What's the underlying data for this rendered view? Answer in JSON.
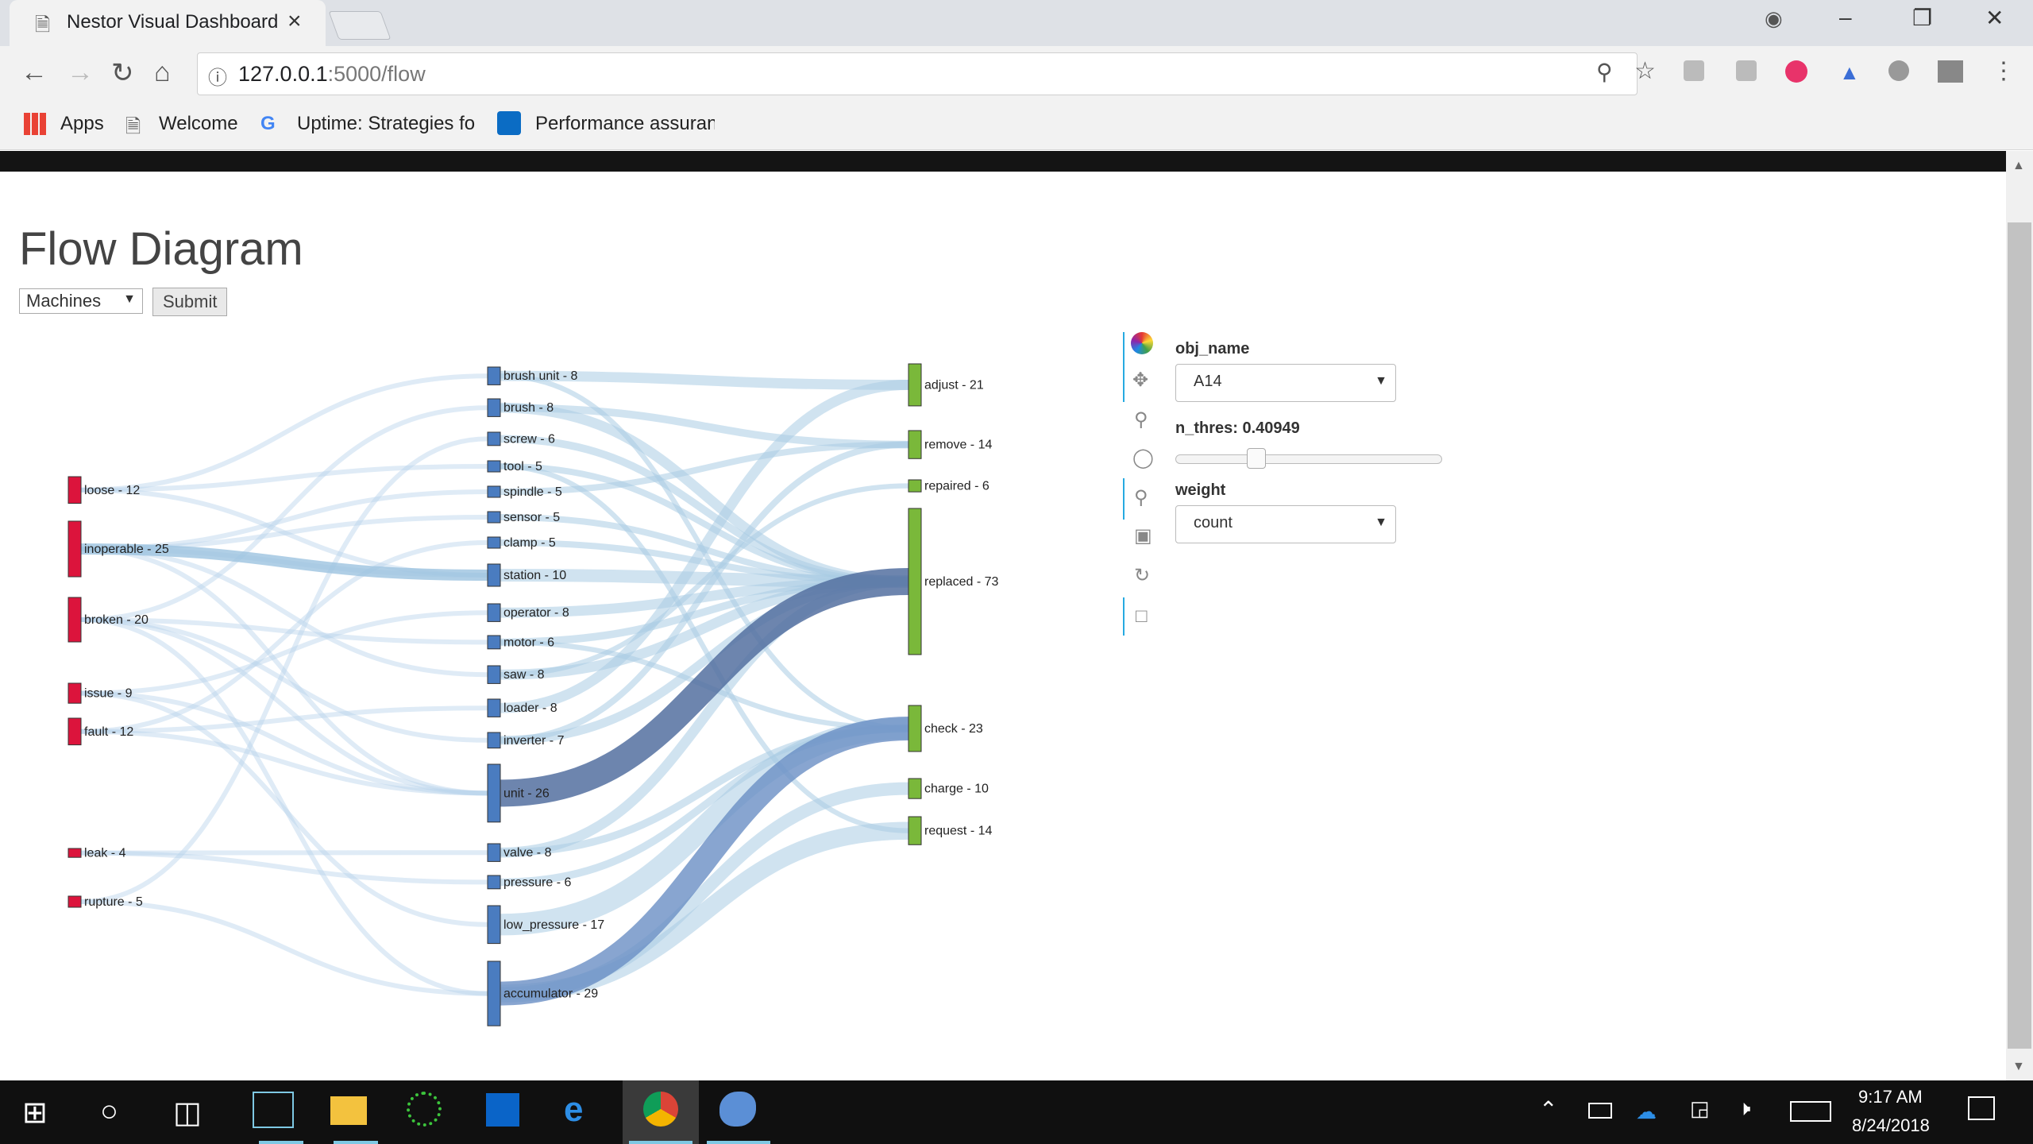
{
  "browser": {
    "tab_title": "Nestor Visual Dashboard",
    "url_host": "127.0.0.1",
    "url_path": ":5000/flow",
    "bookmarks": [
      "Apps",
      "Welcome",
      "Uptime: Strategies fo",
      "Performance assuran"
    ]
  },
  "page": {
    "title": "Flow Diagram",
    "category_select": "Machines",
    "submit_label": "Submit"
  },
  "widgets": {
    "obj_name_label": "obj_name",
    "obj_name_value": "A14",
    "threshold_label": "n_thres: 0.40949",
    "threshold_value": 0.40949,
    "weight_label": "weight",
    "weight_value": "count"
  },
  "diagram": {
    "problems": [
      {
        "label": "loose - 12",
        "count": 12
      },
      {
        "label": "inoperable - 25",
        "count": 25
      },
      {
        "label": "broken - 20",
        "count": 20
      },
      {
        "label": "issue - 9",
        "count": 9
      },
      {
        "label": "fault - 12",
        "count": 12
      },
      {
        "label": "leak - 4",
        "count": 4
      },
      {
        "label": "rupture - 5",
        "count": 5
      }
    ],
    "items": [
      {
        "label": "brush unit - 8",
        "count": 8
      },
      {
        "label": "brush - 8",
        "count": 8
      },
      {
        "label": "screw - 6",
        "count": 6
      },
      {
        "label": "tool - 5",
        "count": 5
      },
      {
        "label": "spindle - 5",
        "count": 5
      },
      {
        "label": "sensor - 5",
        "count": 5
      },
      {
        "label": "clamp - 5",
        "count": 5
      },
      {
        "label": "station - 10",
        "count": 10
      },
      {
        "label": "operator - 8",
        "count": 8
      },
      {
        "label": "motor - 6",
        "count": 6
      },
      {
        "label": "saw - 8",
        "count": 8
      },
      {
        "label": "loader - 8",
        "count": 8
      },
      {
        "label": "inverter - 7",
        "count": 7
      },
      {
        "label": "unit - 26",
        "count": 26
      },
      {
        "label": "valve - 8",
        "count": 8
      },
      {
        "label": "pressure - 6",
        "count": 6
      },
      {
        "label": "low_pressure - 17",
        "count": 17
      },
      {
        "label": "accumulator - 29",
        "count": 29
      }
    ],
    "solutions": [
      {
        "label": "adjust - 21",
        "count": 21
      },
      {
        "label": "remove - 14",
        "count": 14
      },
      {
        "label": "repaired - 6",
        "count": 6
      },
      {
        "label": "replaced - 73",
        "count": 73
      },
      {
        "label": "check - 23",
        "count": 23
      },
      {
        "label": "charge - 10",
        "count": 10
      },
      {
        "label": "request - 14",
        "count": 14
      }
    ],
    "colors": {
      "problem": "#dc143c",
      "item": "#4a7cc0",
      "solution": "#7ab83a",
      "link": "#a9cce3",
      "link_strong": "#5470a0"
    }
  },
  "taskbar": {
    "time": "9:17 AM",
    "date": "8/24/2018"
  }
}
